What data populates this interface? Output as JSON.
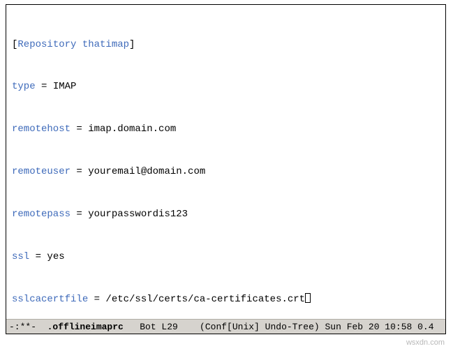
{
  "editor": {
    "section_open": "[",
    "section_kw": "Repository thatimap",
    "section_close": "]",
    "lines": {
      "type_key": "type",
      "type_val": " = IMAP",
      "remotehost_key": "remotehost",
      "remotehost_val": " = imap.domain.com",
      "remoteuser_key": "remoteuser",
      "remoteuser_val": " = youremail@domain.com",
      "remotepass_key": "remotepass",
      "remotepass_val": " = yourpasswordis123",
      "ssl_key": "ssl",
      "ssl_val": " = yes",
      "sslcacertfile_key": "sslcacertfile",
      "sslcacertfile_val": " = /etc/ssl/certs/ca-certificates.crt"
    }
  },
  "modeline": {
    "status": "-:**-  ",
    "buffer": ".offlineimaprc",
    "position": "   Bot L29    ",
    "modes": "(Conf[Unix] Undo-Tree)",
    "time": " Sun Feb 20 10:58 0.4"
  },
  "watermark": "wsxdn.com"
}
